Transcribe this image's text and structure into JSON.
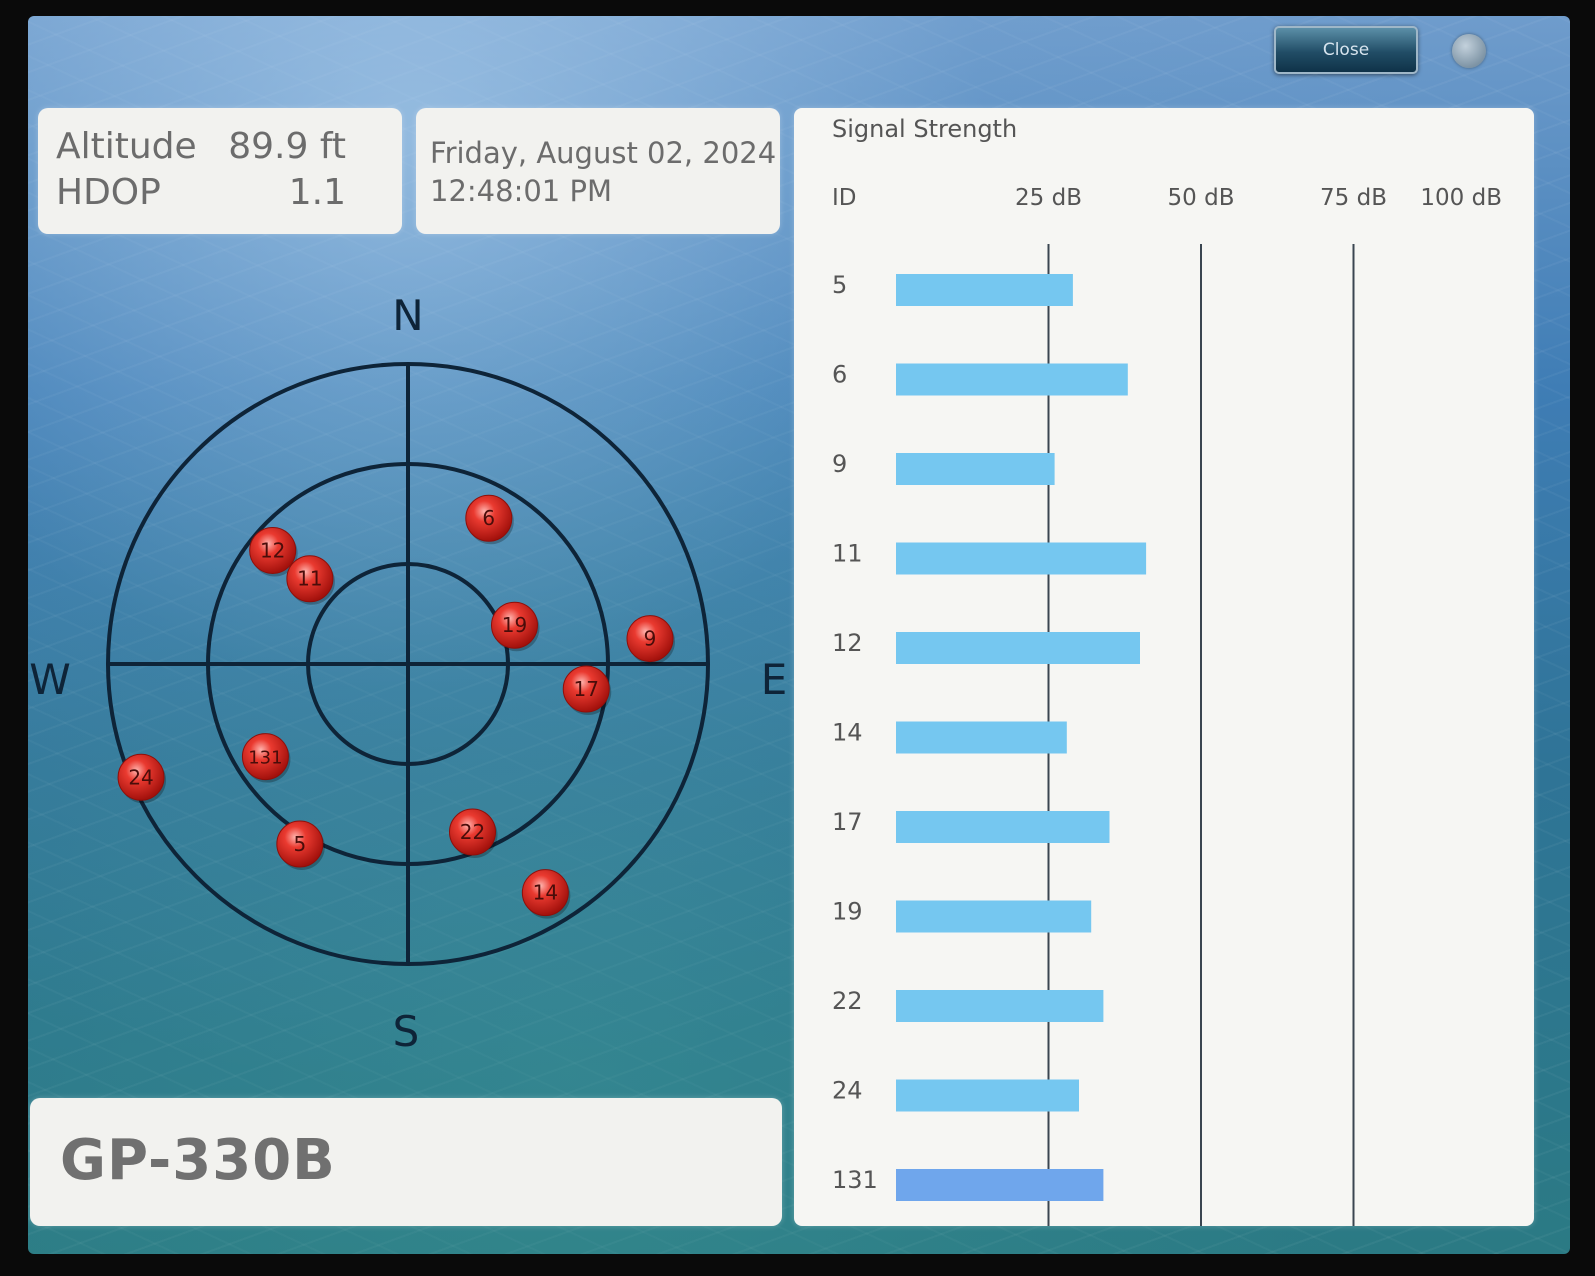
{
  "window": {
    "close_label": "Close"
  },
  "position": {
    "altitude_label": "Altitude",
    "altitude_value": "89.9 ft",
    "hdop_label": "HDOP",
    "hdop_value": "1.1"
  },
  "datetime": {
    "date": "Friday, August 02, 2024",
    "time": "12:48:01 PM"
  },
  "model": "GP-330B",
  "skyplot": {
    "north": "N",
    "south": "S",
    "east": "E",
    "west": "W",
    "satellites": [
      {
        "id": "6",
        "azimuth": 29,
        "elevation": 40
      },
      {
        "id": "12",
        "azimuth": 310,
        "elevation": 37
      },
      {
        "id": "11",
        "azimuth": 311,
        "elevation": 51
      },
      {
        "id": "19",
        "azimuth": 70,
        "elevation": 56
      },
      {
        "id": "9",
        "azimuth": 84,
        "elevation": 17
      },
      {
        "id": "17",
        "azimuth": 98,
        "elevation": 36
      },
      {
        "id": "131",
        "azimuth": 237,
        "elevation": 39
      },
      {
        "id": "24",
        "azimuth": 247,
        "elevation": 3
      },
      {
        "id": "5",
        "azimuth": 211,
        "elevation": 27
      },
      {
        "id": "22",
        "azimuth": 159,
        "elevation": 36
      },
      {
        "id": "14",
        "azimuth": 149,
        "elevation": 10
      }
    ],
    "colors": {
      "ring": "#0e2438",
      "satellite": "#e0261f"
    }
  },
  "chart_data": {
    "type": "bar",
    "title": "Signal Strength",
    "xlabel": "ID",
    "ticks": [
      {
        "value": 25,
        "label": "25 dB"
      },
      {
        "value": 50,
        "label": "50 dB"
      },
      {
        "value": 75,
        "label": "75 dB"
      },
      {
        "value": 100,
        "label": "100 dB"
      }
    ],
    "xlim": [
      0,
      100
    ],
    "categories": [
      "5",
      "6",
      "9",
      "11",
      "12",
      "14",
      "17",
      "19",
      "22",
      "24",
      "131"
    ],
    "values": [
      29,
      38,
      26,
      41,
      40,
      28,
      35,
      32,
      34,
      30,
      34
    ],
    "bar_colors": [
      "#75c7f0",
      "#75c7f0",
      "#75c7f0",
      "#75c7f0",
      "#75c7f0",
      "#75c7f0",
      "#75c7f0",
      "#75c7f0",
      "#75c7f0",
      "#75c7f0",
      "#6fa6ec"
    ],
    "gridlines_at": [
      25,
      50,
      75
    ],
    "grid_color": "#3a4550"
  }
}
